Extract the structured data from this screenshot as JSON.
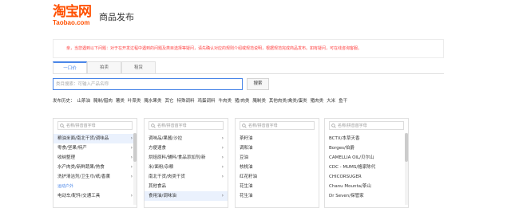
{
  "header": {
    "logo_cn": "淘宝网",
    "logo_en": "Taobao.com",
    "title": "商品发布"
  },
  "notice": {
    "text": "亲，当您遇到以下问题：对于在开发过程中遇到的问题及类目选择等疑问，请先确认对应的规则介绍或规范说明，根据规范完成商品发布。如有疑问，可在线咨询客服。"
  },
  "tabs": [
    {
      "label": "一口价",
      "active": true
    },
    {
      "label": "拍卖"
    },
    {
      "label": "租赁"
    }
  ],
  "search": {
    "placeholder": "类目搜索：可输入产品名称",
    "button_label": "搜索"
  },
  "history": {
    "label": "发布历史：",
    "items": [
      "山茶油",
      "腌制/腊肉",
      "薯类",
      "叶菜类",
      "腌水果类",
      "其它",
      "特殊调料",
      "鸡蛋调料",
      "牛肉类",
      "猪/肉类",
      "腌制类",
      "其他肉类/禽类/蛋类",
      "猪肉类",
      "大米",
      "鱼干"
    ]
  },
  "columns": [
    {
      "placeholder": "名称/拼音首字母",
      "items": [
        {
          "label": "粮油米面/南北干货/调味品",
          "chevron": true,
          "selected": true
        },
        {
          "label": "零食/坚果/特产",
          "chevron": true
        },
        {
          "label": "收纳整理",
          "chevron": true
        },
        {
          "label": "水产肉类/新鲜蔬果/熟食",
          "chevron": true
        },
        {
          "label": "洗护清洁剂/卫生巾/纸/香薰",
          "chevron": true
        },
        {
          "label": "运动户外",
          "group": true
        },
        {
          "label": "电动车/配件/交通工具",
          "chevron": true
        }
      ],
      "scrollbar": true
    },
    {
      "placeholder": "名称/拼音首字母",
      "items": [
        {
          "label": "调味品/果酱/沙拉",
          "chevron": true
        },
        {
          "label": "方便速食",
          "chevron": true
        },
        {
          "label": "烘焙原料/辅料/食品添加剂/新",
          "chevron": true
        },
        {
          "label": "米/面粉/杂粮",
          "chevron": true
        },
        {
          "label": "南北干货/肉类干货",
          "chevron": true
        },
        {
          "label": "其他食品",
          "chevron": false
        },
        {
          "label": "食用油/调味油",
          "chevron": true,
          "selected": true
        }
      ]
    },
    {
      "placeholder": "名称/拼音首字母",
      "items": [
        {
          "label": "茶籽油",
          "chevron": false
        },
        {
          "label": "调和油",
          "chevron": false
        },
        {
          "label": "豆油",
          "chevron": false
        },
        {
          "label": "核桃油",
          "chevron": false
        },
        {
          "label": "红花籽油",
          "chevron": false
        },
        {
          "label": "花生油",
          "chevron": false
        },
        {
          "label": "花生油",
          "chevron": false
        }
      ]
    },
    {
      "placeholder": "名称/拼音首字母",
      "items": [
        {
          "label": "BCTX/本草天香"
        },
        {
          "label": "Borges/伯爵"
        },
        {
          "label": "CAMELLIA OIL/贝尔山"
        },
        {
          "label": "CDC - MUMS/格家陈代"
        },
        {
          "label": "CHICORSUGER"
        },
        {
          "label": "Chanu Mounta/茶山"
        },
        {
          "label": "Dr Seven/探管家"
        }
      ],
      "scrollbar": true
    }
  ]
}
